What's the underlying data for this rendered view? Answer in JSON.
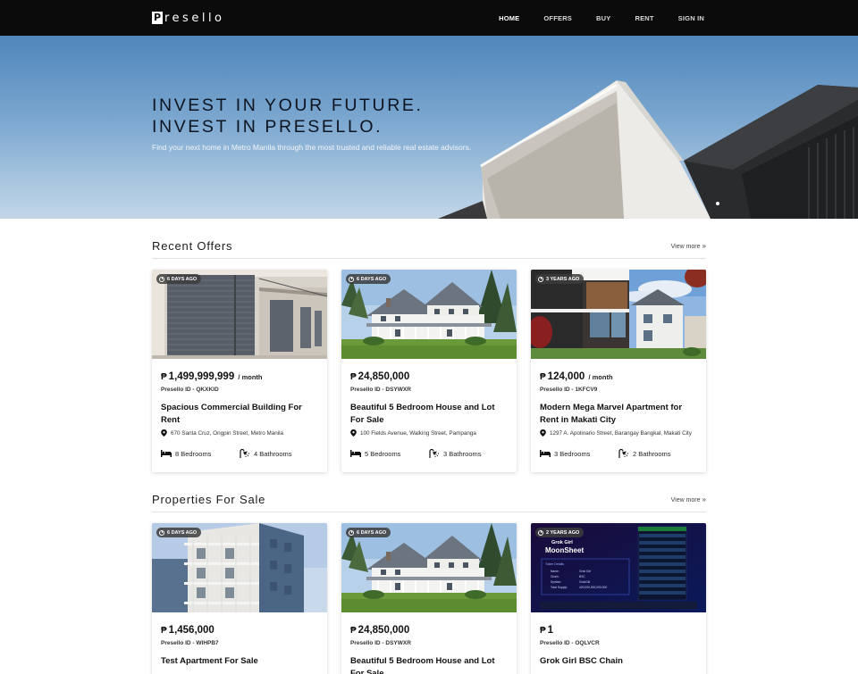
{
  "brand": {
    "mark": "P",
    "name": "resello"
  },
  "nav": [
    {
      "label": "HOME",
      "active": true
    },
    {
      "label": "OFFERS",
      "active": false
    },
    {
      "label": "BUY",
      "active": false
    },
    {
      "label": "RENT",
      "active": false
    },
    {
      "label": "SIGN IN",
      "active": false
    }
  ],
  "hero": {
    "line1": "INVEST IN YOUR FUTURE.",
    "line2": "INVEST IN PRESELLO.",
    "subtitle": "Find your next home in Metro Manila through the most trusted and reliable real estate advisors."
  },
  "currency": "₱",
  "sections": [
    {
      "title": "Recent Offers",
      "view_more": "View more",
      "cards": [
        {
          "badge": "6 DAYS AGO",
          "price": "1,499,999,999",
          "per": "/ month",
          "pid": "Presello ID - QKXKID",
          "title": "Spacious Commercial Building For Rent",
          "address": "670 Santa Cruz, Ongpin Street, Metro Manila",
          "bedrooms": "8 Bedrooms",
          "bathrooms": "4 Bathrooms",
          "image": "commercial-shutters"
        },
        {
          "badge": "6 DAYS AGO",
          "price": "24,850,000",
          "per": "",
          "pid": "Presello ID - DSYWXR",
          "title": "Beautiful 5 Bedroom House and Lot For Sale",
          "address": "100 Fields Avenue, Walking Street, Pampanga",
          "bedrooms": "5 Bedrooms",
          "bathrooms": "3 Bathrooms",
          "image": "white-house"
        },
        {
          "badge": "3 YEARS AGO",
          "price": "124,000",
          "per": "/ month",
          "pid": "Presello ID - 1KFCV9",
          "title": "Modern Mega Marvel Apartment for Rent in Makati City",
          "address": "1297 A. Apolinario Street, Barangay Bangkal, Makati City",
          "bedrooms": "3 Bedrooms",
          "bathrooms": "2 Bathrooms",
          "image": "modern-house"
        }
      ]
    },
    {
      "title": "Properties For Sale",
      "view_more": "View more",
      "cards": [
        {
          "badge": "6 DAYS AGO",
          "price": "1,456,000",
          "per": "",
          "pid": "Presello ID - WIHPB7",
          "title": "Test Apartment For Sale",
          "image": "apartment-block"
        },
        {
          "badge": "6 DAYS AGO",
          "price": "24,850,000",
          "per": "",
          "pid": "Presello ID - DSYWXR",
          "title": "Beautiful 5 Bedroom House and Lot For Sale",
          "image": "white-house"
        },
        {
          "badge": "2 YEARS AGO",
          "price": "1",
          "per": "",
          "pid": "Presello ID - OQLVCR",
          "title": "Grok Girl BSC Chain",
          "image": "moonsheet",
          "img_text": {
            "brand": "Grok Girl",
            "heading": "MoonSheet",
            "subheading": "Token Details",
            "rows": [
              [
                "Name:",
                "Grok Girl"
              ],
              [
                "Chain:",
                "BSC"
              ],
              [
                "Symbol:",
                "GrokGirl"
              ],
              [
                "Total Supply:",
                "420,000,000,000,000"
              ]
            ]
          }
        }
      ]
    }
  ],
  "colors": {
    "navbar": "#0b0b0b",
    "sky": "#6e9dca",
    "card_bg": "#ffffff"
  }
}
